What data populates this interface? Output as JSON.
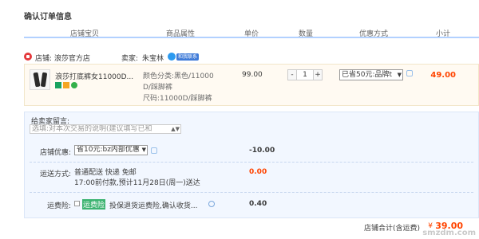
{
  "page_title": "确认订单信息",
  "columns": [
    "店铺宝贝",
    "商品属性",
    "单价",
    "数量",
    "优惠方式",
    "小计"
  ],
  "shop": {
    "label_prefix": "店铺:",
    "name": "浪莎官方店",
    "seller_label": "卖家:",
    "seller_name": "朱宝林",
    "badge": "和我联系",
    "icon": "shop-icon"
  },
  "item": {
    "title": "浪莎打底裤女11000D...",
    "props_line1": "颜色分类:黑色/11000",
    "props_line2": "D/踩脚裤",
    "props_line3": "尺码:11000D/踩脚裤",
    "price": "99.00",
    "quantity": "1",
    "minus": "-",
    "plus": "+",
    "promotion": "已省50元:品牌t",
    "subtotal": "49.00"
  },
  "note": {
    "label": "给卖家留言:",
    "placeholder": "选填:对本次交易的说明(建议填写已和"
  },
  "coupon": {
    "label": "店铺优惠:",
    "selected": "省10元:bz内部优惠",
    "amount": "-10.00"
  },
  "shipping": {
    "label": "运送方式:",
    "method": "普通配送 快递 免邮",
    "schedule": "17:00前付款,预计11月28日(周一)送达",
    "fee": "0.00"
  },
  "insurance": {
    "label": "运费险:",
    "name": "运费险",
    "desc": "投保退货运费险,确认收货...",
    "amount": "0.40"
  },
  "total": {
    "label": "店铺合计(含运费)",
    "currency": "¥",
    "amount": "39.00"
  },
  "watermark": "smzdm.com",
  "colors": {
    "accent": "#ff4400",
    "header_rule": "#b2d1ff",
    "item_bg": "#fffaf2",
    "lower_bg": "#f2f7ff"
  }
}
